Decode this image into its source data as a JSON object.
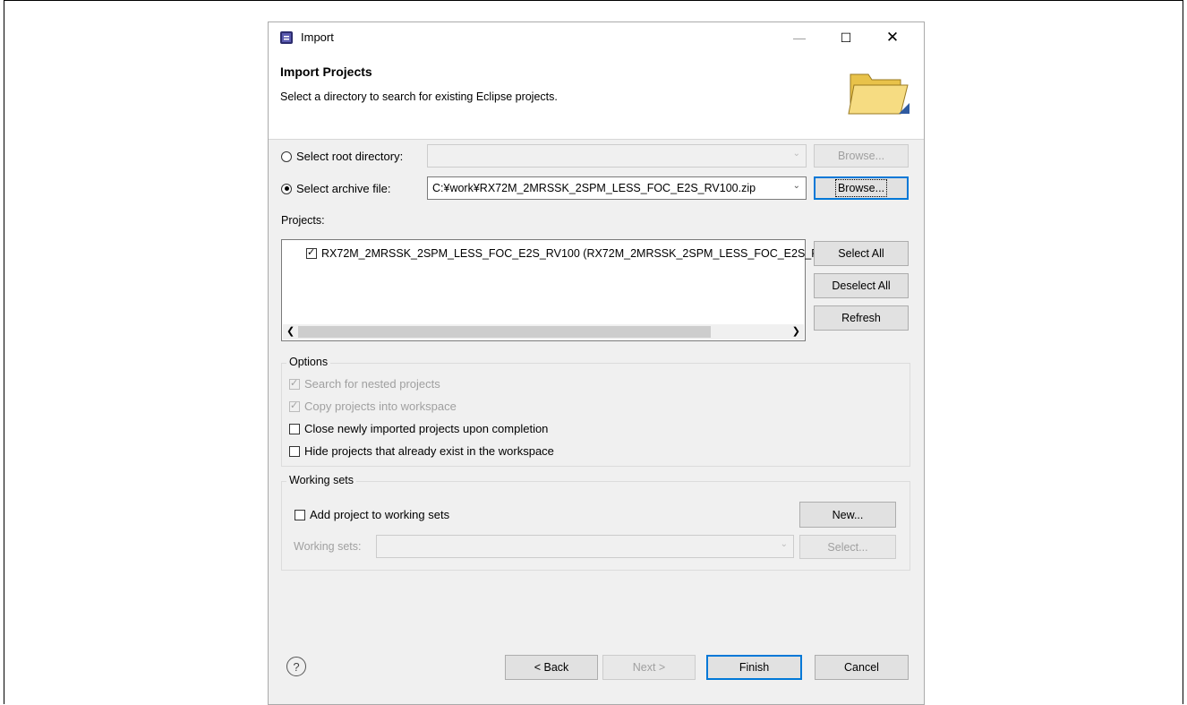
{
  "dialog": {
    "title": "Import"
  },
  "banner": {
    "title": "Import Projects",
    "description": "Select a directory to search for existing Eclipse projects."
  },
  "source": {
    "root_directory_label": "Select root directory:",
    "root_directory_value": "",
    "root_browse_label": "Browse...",
    "archive_file_label": "Select archive file:",
    "archive_file_value": "C:¥work¥RX72M_2MRSSK_2SPM_LESS_FOC_E2S_RV100.zip",
    "archive_browse_label": "Browse...",
    "selected": "archive"
  },
  "projects": {
    "label": "Projects:",
    "items": [
      {
        "label": "RX72M_2MRSSK_2SPM_LESS_FOC_E2S_RV100 (RX72M_2MRSSK_2SPM_LESS_FOC_E2S_F",
        "checked": true
      }
    ],
    "select_all_label": "Select All",
    "deselect_all_label": "Deselect All",
    "refresh_label": "Refresh"
  },
  "options": {
    "title": "Options",
    "items": [
      {
        "label": "Search for nested projects",
        "checked": true,
        "enabled": false
      },
      {
        "label": "Copy projects into workspace",
        "checked": true,
        "enabled": false
      },
      {
        "label": "Close newly imported projects upon completion",
        "checked": false,
        "enabled": true
      },
      {
        "label": "Hide projects that already exist in the workspace",
        "checked": false,
        "enabled": true
      }
    ]
  },
  "working_sets": {
    "title": "Working sets",
    "add_label": "Add project to working sets",
    "add_checked": false,
    "new_label": "New...",
    "sets_label": "Working sets:",
    "sets_value": "",
    "select_label": "Select..."
  },
  "footer": {
    "help_glyph": "?",
    "back_label": "< Back",
    "next_label": "Next >",
    "finish_label": "Finish",
    "cancel_label": "Cancel"
  }
}
